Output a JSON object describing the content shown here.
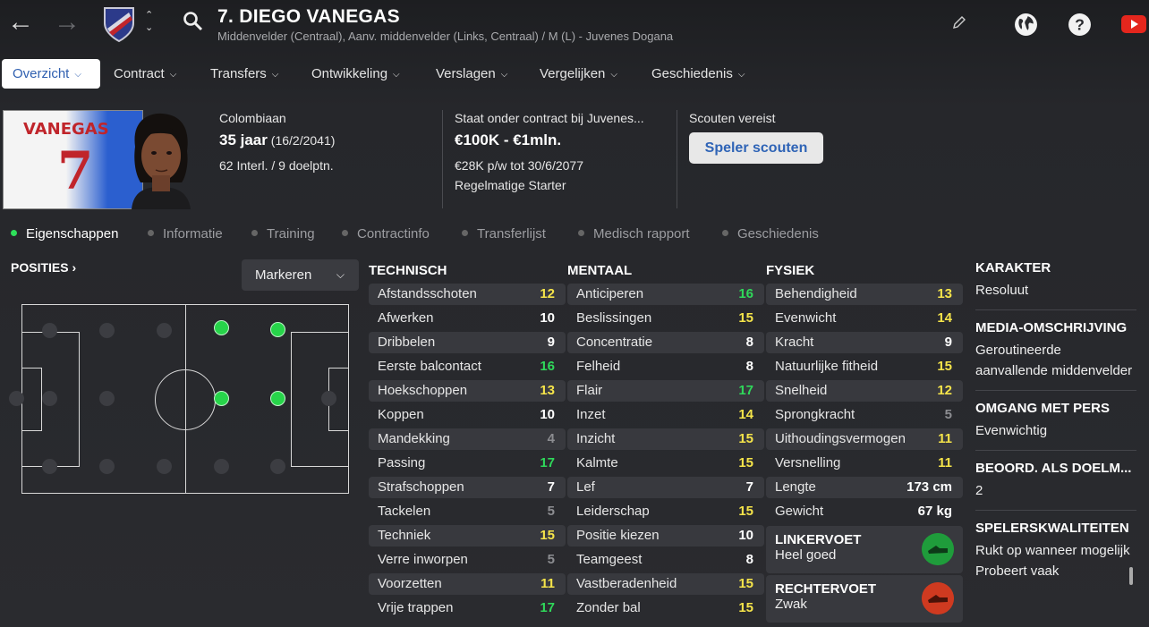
{
  "header": {
    "title": "7. DIEGO VANEGAS",
    "subtitle": "Middenvelder (Centraal), Aanv. middenvelder (Links, Centraal) / M (L) - Juvenes Dogana",
    "icons": [
      "back-arrow-icon",
      "forward-arrow-icon",
      "club-crest-icon",
      "up-down-icon",
      "search-icon",
      "edit-pencil-icon",
      "globe-icon",
      "help-icon",
      "youtube-icon"
    ]
  },
  "tabs": [
    "Overzicht",
    "Contract",
    "Transfers",
    "Ontwikkeling",
    "Verslagen",
    "Vergelijken",
    "Geschiedenis"
  ],
  "profile": {
    "shirt_name": "VANEGAS",
    "shirt_number": "7",
    "nationality": "Colombiaan",
    "age": "35 jaar",
    "dob": "(16/2/2041)",
    "caps": "62 Interl. / 9 doelptn.",
    "contract_header": "Staat onder contract bij Juvenes...",
    "value": "€100K - €1mln.",
    "wage": "€28K p/w tot 30/6/2077",
    "role": "Regelmatige Starter",
    "scout_label": "Scouten vereist",
    "scout_button": "Speler scouten"
  },
  "subtabs": [
    "Eigenschappen",
    "Informatie",
    "Training",
    "Contractinfo",
    "Transferlijst",
    "Medisch rapport",
    "Geschiedenis"
  ],
  "positions": {
    "title": "POSITIES",
    "dropdown": "Markeren"
  },
  "technical": {
    "title": "TECHNISCH",
    "items": [
      {
        "name": "Afstandsschoten",
        "value": "12"
      },
      {
        "name": "Afwerken",
        "value": "10"
      },
      {
        "name": "Dribbelen",
        "value": "9"
      },
      {
        "name": "Eerste balcontact",
        "value": "16"
      },
      {
        "name": "Hoekschoppen",
        "value": "13"
      },
      {
        "name": "Koppen",
        "value": "10"
      },
      {
        "name": "Mandekking",
        "value": "4"
      },
      {
        "name": "Passing",
        "value": "17"
      },
      {
        "name": "Strafschoppen",
        "value": "7"
      },
      {
        "name": "Tackelen",
        "value": "5"
      },
      {
        "name": "Techniek",
        "value": "15"
      },
      {
        "name": "Verre inworpen",
        "value": "5"
      },
      {
        "name": "Voorzetten",
        "value": "11"
      },
      {
        "name": "Vrije trappen",
        "value": "17"
      }
    ]
  },
  "mental": {
    "title": "MENTAAL",
    "items": [
      {
        "name": "Anticiperen",
        "value": "16"
      },
      {
        "name": "Beslissingen",
        "value": "15"
      },
      {
        "name": "Concentratie",
        "value": "8"
      },
      {
        "name": "Felheid",
        "value": "8"
      },
      {
        "name": "Flair",
        "value": "17"
      },
      {
        "name": "Inzet",
        "value": "14"
      },
      {
        "name": "Inzicht",
        "value": "15"
      },
      {
        "name": "Kalmte",
        "value": "15"
      },
      {
        "name": "Lef",
        "value": "7"
      },
      {
        "name": "Leiderschap",
        "value": "15"
      },
      {
        "name": "Positie kiezen",
        "value": "10"
      },
      {
        "name": "Teamgeest",
        "value": "8"
      },
      {
        "name": "Vastberadenheid",
        "value": "15"
      },
      {
        "name": "Zonder bal",
        "value": "15"
      }
    ]
  },
  "physical": {
    "title": "FYSIEK",
    "items": [
      {
        "name": "Behendigheid",
        "value": "13"
      },
      {
        "name": "Evenwicht",
        "value": "14"
      },
      {
        "name": "Kracht",
        "value": "9"
      },
      {
        "name": "Natuurlijke fitheid",
        "value": "15"
      },
      {
        "name": "Snelheid",
        "value": "12"
      },
      {
        "name": "Sprongkracht",
        "value": "5"
      },
      {
        "name": "Uithoudingsvermogen",
        "value": "11"
      },
      {
        "name": "Versnelling",
        "value": "11"
      },
      {
        "name": "Lengte",
        "value": "173 cm"
      },
      {
        "name": "Gewicht",
        "value": "67 kg"
      }
    ],
    "left_foot": {
      "title": "LINKERVOET",
      "value": "Heel goed"
    },
    "right_foot": {
      "title": "RECHTERVOET",
      "value": "Zwak"
    }
  },
  "right_panel": {
    "karakter_title": "KARAKTER",
    "karakter": "Resoluut",
    "media_title": "MEDIA-OMSCHRIJVING",
    "media": "Geroutineerde aanvallende middenvelder",
    "pers_title": "OMGANG MET PERS",
    "pers": "Evenwichtig",
    "keeper_title": "BEOORD. ALS DOELM...",
    "keeper": "2",
    "qual_title": "SPELERSKWALITEITEN",
    "qual": "Rukt op wanneer mogelijk",
    "qual2": "Probeert vaak"
  },
  "colors": {
    "green": "#2fd85a",
    "yellow": "#f5e44a",
    "white": "#ffffff",
    "grey": "#8c8d91",
    "accent": "#2f64b6"
  }
}
